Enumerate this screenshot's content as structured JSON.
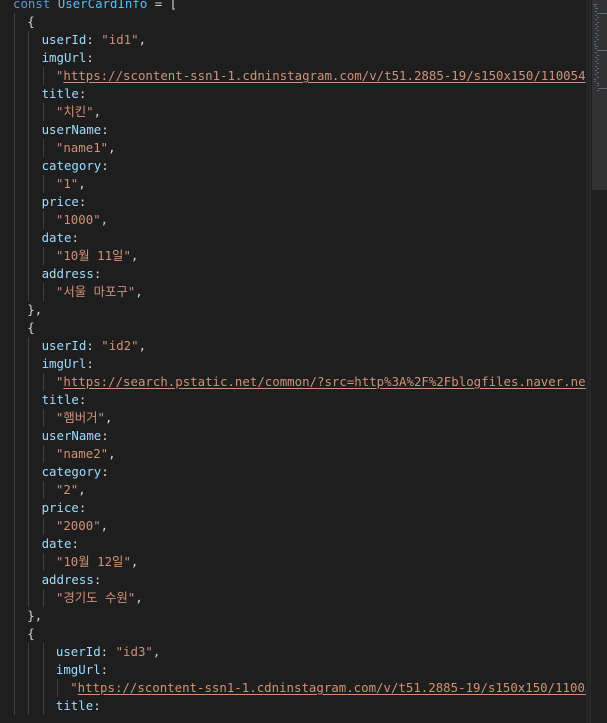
{
  "editor": {
    "lines": [
      {
        "indent": 0,
        "tokens": [
          {
            "t": "kw",
            "v": "const "
          },
          {
            "t": "cls",
            "v": "UserCardInfo"
          },
          {
            "t": "punc",
            "v": " = ["
          }
        ]
      },
      {
        "indent": 1,
        "tokens": [
          {
            "t": "punc",
            "v": "{"
          }
        ]
      },
      {
        "indent": 2,
        "tokens": [
          {
            "t": "prop",
            "v": "userId"
          },
          {
            "t": "punc",
            "v": ": "
          },
          {
            "t": "str",
            "v": "\"id1\""
          },
          {
            "t": "punc",
            "v": ","
          }
        ]
      },
      {
        "indent": 2,
        "tokens": [
          {
            "t": "prop",
            "v": "imgUrl"
          },
          {
            "t": "punc",
            "v": ":"
          }
        ]
      },
      {
        "indent": 3,
        "tokens": [
          {
            "t": "str",
            "v": "\""
          },
          {
            "t": "url",
            "v": "https://scontent-ssn1-1.cdninstagram.com/v/t51.2885-19/s150x150/110054"
          }
        ]
      },
      {
        "indent": 2,
        "tokens": [
          {
            "t": "prop",
            "v": "title"
          },
          {
            "t": "punc",
            "v": ":"
          }
        ]
      },
      {
        "indent": 3,
        "tokens": [
          {
            "t": "str",
            "v": "\"치킨\""
          },
          {
            "t": "punc",
            "v": ","
          }
        ]
      },
      {
        "indent": 2,
        "tokens": [
          {
            "t": "prop",
            "v": "userName"
          },
          {
            "t": "punc",
            "v": ":"
          }
        ]
      },
      {
        "indent": 3,
        "tokens": [
          {
            "t": "str",
            "v": "\"name1\""
          },
          {
            "t": "punc",
            "v": ","
          }
        ]
      },
      {
        "indent": 2,
        "tokens": [
          {
            "t": "prop",
            "v": "category"
          },
          {
            "t": "punc",
            "v": ":"
          }
        ]
      },
      {
        "indent": 3,
        "tokens": [
          {
            "t": "str",
            "v": "\"1\""
          },
          {
            "t": "punc",
            "v": ","
          }
        ]
      },
      {
        "indent": 2,
        "tokens": [
          {
            "t": "prop",
            "v": "price"
          },
          {
            "t": "punc",
            "v": ":"
          }
        ]
      },
      {
        "indent": 3,
        "tokens": [
          {
            "t": "str",
            "v": "\"1000\""
          },
          {
            "t": "punc",
            "v": ","
          }
        ]
      },
      {
        "indent": 2,
        "tokens": [
          {
            "t": "prop",
            "v": "date"
          },
          {
            "t": "punc",
            "v": ":"
          }
        ]
      },
      {
        "indent": 3,
        "tokens": [
          {
            "t": "str",
            "v": "\"10월 11일\""
          },
          {
            "t": "punc",
            "v": ","
          }
        ]
      },
      {
        "indent": 2,
        "tokens": [
          {
            "t": "prop",
            "v": "address"
          },
          {
            "t": "punc",
            "v": ":"
          }
        ]
      },
      {
        "indent": 3,
        "tokens": [
          {
            "t": "str",
            "v": "\"서울 마포구\""
          },
          {
            "t": "punc",
            "v": ","
          }
        ]
      },
      {
        "indent": 1,
        "tokens": [
          {
            "t": "punc",
            "v": "},"
          }
        ]
      },
      {
        "indent": 1,
        "tokens": [
          {
            "t": "punc",
            "v": "{"
          }
        ]
      },
      {
        "indent": 2,
        "tokens": [
          {
            "t": "prop",
            "v": "userId"
          },
          {
            "t": "punc",
            "v": ": "
          },
          {
            "t": "str",
            "v": "\"id2\""
          },
          {
            "t": "punc",
            "v": ","
          }
        ]
      },
      {
        "indent": 2,
        "tokens": [
          {
            "t": "prop",
            "v": "imgUrl"
          },
          {
            "t": "punc",
            "v": ":"
          }
        ]
      },
      {
        "indent": 3,
        "tokens": [
          {
            "t": "str",
            "v": "\""
          },
          {
            "t": "url",
            "v": "https://search.pstatic.net/common/?src=http%3A%2F%2Fblogfiles.naver.net"
          }
        ]
      },
      {
        "indent": 2,
        "tokens": [
          {
            "t": "prop",
            "v": "title"
          },
          {
            "t": "punc",
            "v": ":"
          }
        ]
      },
      {
        "indent": 3,
        "tokens": [
          {
            "t": "str",
            "v": "\"햄버거\""
          },
          {
            "t": "punc",
            "v": ","
          }
        ]
      },
      {
        "indent": 2,
        "tokens": [
          {
            "t": "prop",
            "v": "userName"
          },
          {
            "t": "punc",
            "v": ":"
          }
        ]
      },
      {
        "indent": 3,
        "tokens": [
          {
            "t": "str",
            "v": "\"name2\""
          },
          {
            "t": "punc",
            "v": ","
          }
        ]
      },
      {
        "indent": 2,
        "tokens": [
          {
            "t": "prop",
            "v": "category"
          },
          {
            "t": "punc",
            "v": ":"
          }
        ]
      },
      {
        "indent": 3,
        "tokens": [
          {
            "t": "str",
            "v": "\"2\""
          },
          {
            "t": "punc",
            "v": ","
          }
        ]
      },
      {
        "indent": 2,
        "tokens": [
          {
            "t": "prop",
            "v": "price"
          },
          {
            "t": "punc",
            "v": ":"
          }
        ]
      },
      {
        "indent": 3,
        "tokens": [
          {
            "t": "str",
            "v": "\"2000\""
          },
          {
            "t": "punc",
            "v": ","
          }
        ]
      },
      {
        "indent": 2,
        "tokens": [
          {
            "t": "prop",
            "v": "date"
          },
          {
            "t": "punc",
            "v": ":"
          }
        ]
      },
      {
        "indent": 3,
        "tokens": [
          {
            "t": "str",
            "v": "\"10월 12일\""
          },
          {
            "t": "punc",
            "v": ","
          }
        ]
      },
      {
        "indent": 2,
        "tokens": [
          {
            "t": "prop",
            "v": "address"
          },
          {
            "t": "punc",
            "v": ":"
          }
        ]
      },
      {
        "indent": 3,
        "tokens": [
          {
            "t": "str",
            "v": "\"경기도 수원\""
          },
          {
            "t": "punc",
            "v": ","
          }
        ]
      },
      {
        "indent": 1,
        "tokens": [
          {
            "t": "punc",
            "v": "},"
          }
        ]
      },
      {
        "indent": 1,
        "tokens": [
          {
            "t": "punc",
            "v": "{"
          }
        ]
      },
      {
        "indent": 3,
        "tokens": [
          {
            "t": "prop",
            "v": "userId"
          },
          {
            "t": "punc",
            "v": ": "
          },
          {
            "t": "str",
            "v": "\"id3\""
          },
          {
            "t": "punc",
            "v": ","
          }
        ]
      },
      {
        "indent": 3,
        "tokens": [
          {
            "t": "prop",
            "v": "imgUrl"
          },
          {
            "t": "punc",
            "v": ":"
          }
        ]
      },
      {
        "indent": 4,
        "tokens": [
          {
            "t": "str",
            "v": "\""
          },
          {
            "t": "url",
            "v": "https://scontent-ssn1-1.cdninstagram.com/v/t51.2885-19/s150x150/11005"
          }
        ]
      },
      {
        "indent": 3,
        "tokens": [
          {
            "t": "prop",
            "v": "title"
          },
          {
            "t": "punc",
            "v": ":"
          }
        ]
      }
    ]
  },
  "colors": {
    "background": "#1e1e1e",
    "keyword": "#569cd6",
    "class": "#4fc1ff",
    "property": "#9cdcfe",
    "string": "#ce9178",
    "punctuation": "#d4d4d4"
  }
}
